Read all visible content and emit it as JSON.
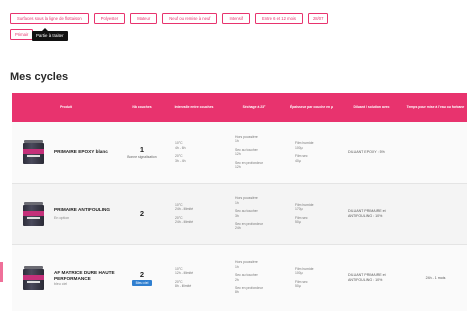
{
  "filters": {
    "row1": [
      "Surfaces sous la ligne de flottaison",
      "Polyester",
      "Mateur",
      "Neuf ou remise à neuf",
      "Intensif",
      "Entre 6 et 12 mois",
      "28/07"
    ],
    "row2": [
      "Primair"
    ],
    "tooltip": "Partie à traiter"
  },
  "page_title": "Mes cycles",
  "table": {
    "headers": [
      "Produit",
      "Nb couches",
      "Intervalle entre couches",
      "Séchage à 23°",
      "Épaisseur par couche en µ",
      "Diluant / solution avec",
      "Temps pour mise à l'eau ou forbane"
    ],
    "rows": [
      {
        "product": "PRIMAIRE EPOXY blanc",
        "product_sub": "",
        "count": "1",
        "count_sub": "Bonne signalisation",
        "count_badge": "",
        "intervals": [
          "10°C",
          "4h - 6h",
          "20°C",
          "3h - 4h"
        ],
        "drying": [
          "Hors poussière",
          "1h",
          "Sec au toucher",
          "12h",
          "Sec en profondeur",
          "12h"
        ],
        "thickness": [
          "Film humide",
          "100µ",
          "Film sec",
          "40µ"
        ],
        "diluant": [
          "DILUANT EPOXY : 5%"
        ],
        "temps": ""
      },
      {
        "product": "PRIMAIRE ANTIFOULING",
        "product_sub": "En option",
        "count": "2",
        "count_sub": "",
        "count_badge": "",
        "intervals": [
          "10°C",
          "24h - illimité",
          "20°C",
          "24h - illimité"
        ],
        "drying": [
          "Hors poussière",
          "1h",
          "Sec au toucher",
          "3h",
          "Sec en profondeur",
          "24h"
        ],
        "thickness": [
          "Film humide",
          "170µ",
          "Film sec",
          "50µ"
        ],
        "diluant": [
          "DILUANT PRIMAIRE et",
          "ANTIFOULING : 10%"
        ],
        "temps": ""
      },
      {
        "product": "AF MATRICE DURE HAUTE PERFORMANCE",
        "product_sub": "bleu ciel",
        "count": "2",
        "count_sub": "",
        "count_badge": "Bleu ciel",
        "intervals": [
          "10°C",
          "12h - illimité",
          "20°C",
          "8h - illimité"
        ],
        "drying": [
          "Hors poussière",
          "1h",
          "Sec au toucher",
          "2h",
          "Sec en profondeur",
          "8h"
        ],
        "thickness": [
          "Film humide",
          "100µ",
          "Film sec",
          "50µ"
        ],
        "diluant": [
          "DILUANT PRIMAIRE et",
          "ANTIFOULING : 10%"
        ],
        "temps": "24h - 1 mois"
      }
    ]
  },
  "colors": {
    "accent": "#e8336e",
    "badge": "#2f7fd0"
  }
}
